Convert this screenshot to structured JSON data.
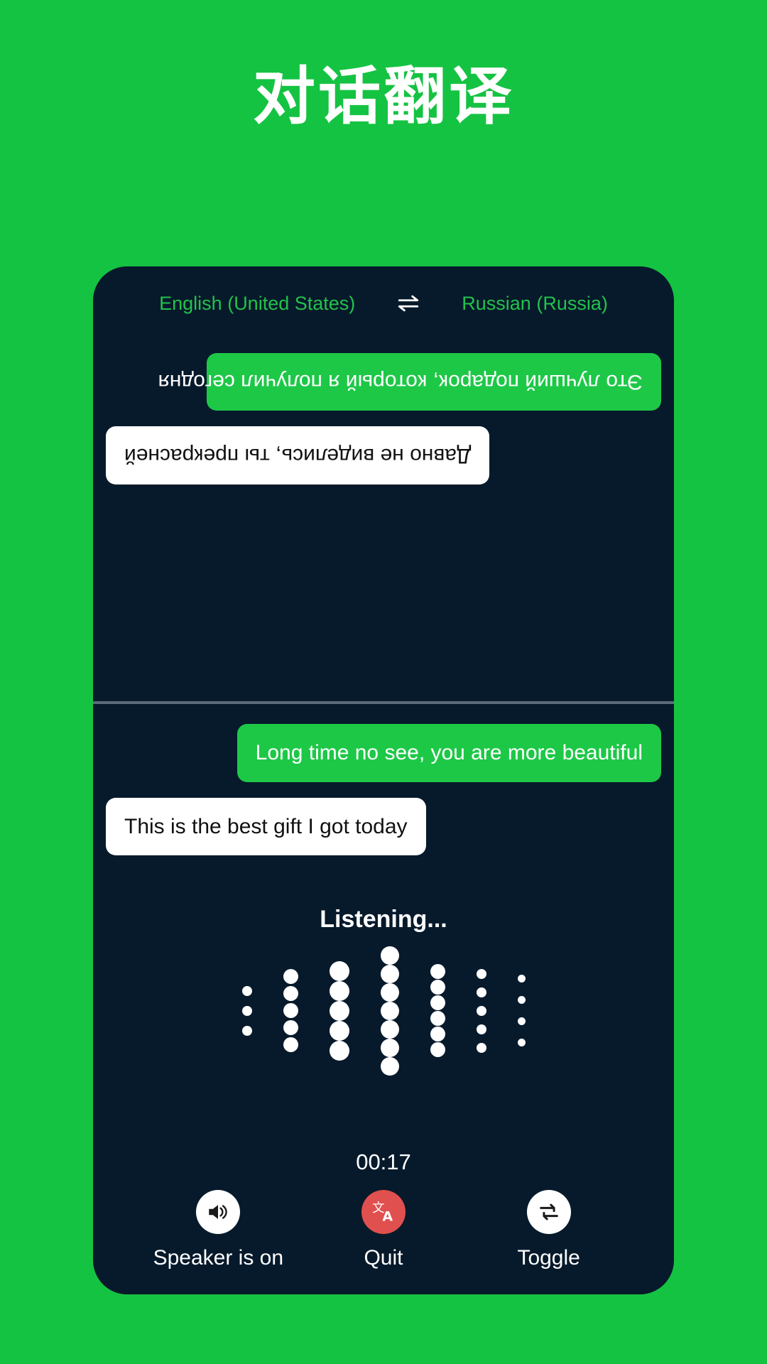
{
  "page": {
    "title": "对话翻译",
    "background_color": "#15c342",
    "card_color": "#071a2b",
    "accent_green": "#1dc847",
    "accent_red": "#e0504e"
  },
  "language_bar": {
    "source_language": "English (United States)",
    "target_language": "Russian (Russia)",
    "swap_icon": "swap-horizontal-icon"
  },
  "remote_pane": {
    "orientation": "rotated-180",
    "messages": [
      {
        "text": "Это лучший подарок, который я получил сегодня",
        "style": "green",
        "align": "left"
      },
      {
        "text": "Давно не виделись, ты прекрасней",
        "style": "white",
        "align": "right"
      }
    ]
  },
  "local_pane": {
    "messages": [
      {
        "text": "Long time no see, you are more beautiful",
        "style": "green",
        "align": "right"
      },
      {
        "text": "This is the best gift I got today",
        "style": "white",
        "align": "left"
      }
    ]
  },
  "listening": {
    "status_text": "Listening...",
    "timer": "00:17",
    "waveform_columns": [
      {
        "dot_size": 14,
        "count": 3,
        "gap": 28
      },
      {
        "dot_size": 21,
        "count": 5,
        "gap": 24
      },
      {
        "dot_size": 28,
        "count": 5,
        "gap": 22
      },
      {
        "dot_size": 26,
        "count": 7,
        "gap": 18
      },
      {
        "dot_size": 21,
        "count": 6,
        "gap": 22
      },
      {
        "dot_size": 14,
        "count": 5,
        "gap": 26
      },
      {
        "dot_size": 11,
        "count": 4,
        "gap": 30
      }
    ]
  },
  "controls": [
    {
      "label": "Speaker is on",
      "icon": "speaker-on-icon",
      "circle": "white"
    },
    {
      "label": "Quit",
      "icon": "translate-icon",
      "circle": "red"
    },
    {
      "label": "Toggle",
      "icon": "toggle-swap-icon",
      "circle": "white"
    }
  ]
}
